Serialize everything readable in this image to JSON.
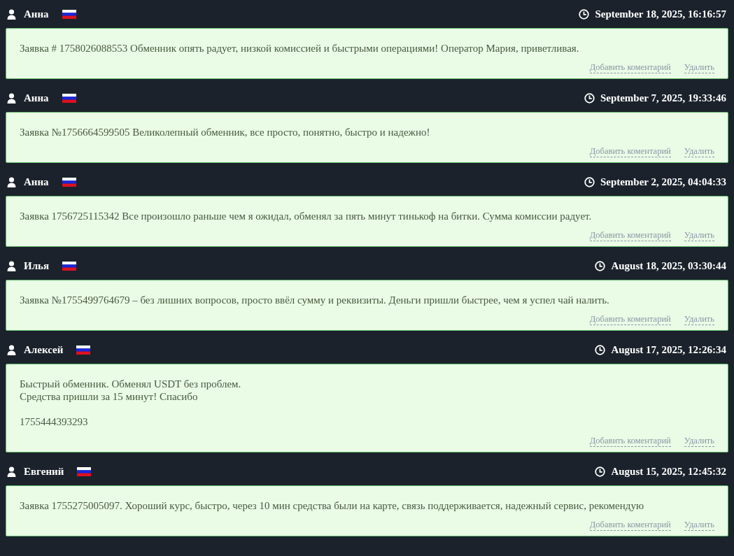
{
  "reviews": [
    {
      "author": "Анна",
      "date": "September 18, 2025, 16:16:57",
      "text": "Заявка # 1758026088553 Обменник опять радует, низкой комиссией и быстрыми операциями! Оператор Мария, приветливая.",
      "actions": [
        "Добавить коментарий",
        "Удалить"
      ]
    },
    {
      "author": "Анна",
      "date": "September 7, 2025, 19:33:46",
      "text": "Заявка №1756664599505 Великолепный обменник, все просто, понятно, быстро и надежно!",
      "actions": [
        "Добавить коментарий",
        "Удалить"
      ]
    },
    {
      "author": "Анна",
      "date": "September 2, 2025, 04:04:33",
      "text": "Заявка 1756725115342 Все произошло раньше чем я ожидал, обменял за пять минут тинькоф на битки. Сумма комиссии радует.",
      "actions": [
        "Добавить коментарий",
        "Удалить"
      ]
    },
    {
      "author": "Илья",
      "date": "August 18, 2025, 03:30:44",
      "text": "Заявка №1755499764679 – без лишних вопросов, просто ввёл сумму и реквизиты. Деньги пришли быстрее, чем я успел чай налить.",
      "actions": [
        "Добавить коментарий",
        "Удалить"
      ]
    },
    {
      "author": "Алексей",
      "date": "August 17, 2025, 12:26:34",
      "text": "Быстрый обменник. Обменял USDT без проблем.\nСредства пришли за 15 минут! Спасибо\n\n1755444393293",
      "actions": [
        "Добавить коментарий",
        "Удалить"
      ]
    },
    {
      "author": "Евгений",
      "date": "August 15, 2025, 12:45:32",
      "text": "Заявка 1755275005097. Хороший курс, быстро, через 10 мин средства были на карте, связь поддерживается, надежный сервис, рекомендую",
      "actions": [
        "Добавить коментарий",
        "Удалить"
      ]
    }
  ]
}
